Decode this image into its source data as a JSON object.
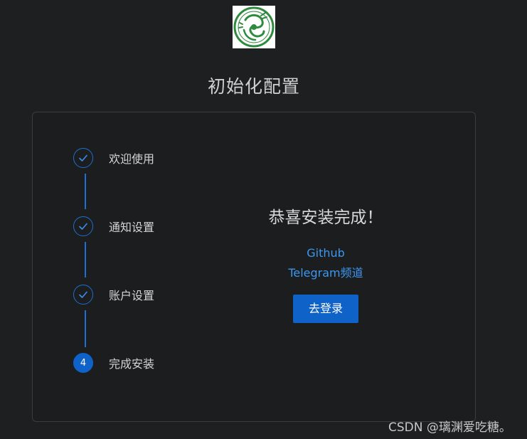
{
  "header": {
    "logo_icon": "dragon-logo-icon",
    "title": "初始化配置"
  },
  "steps": [
    {
      "label": "欢迎使用",
      "status": "done",
      "icon": "check-icon"
    },
    {
      "label": "通知设置",
      "status": "done",
      "icon": "check-icon"
    },
    {
      "label": "账户设置",
      "status": "done",
      "icon": "check-icon"
    },
    {
      "label": "完成安装",
      "status": "current",
      "number": "4"
    }
  ],
  "result": {
    "title": "恭喜安装完成！",
    "links": [
      "Github",
      "Telegram频道"
    ],
    "login_label": "去登录"
  },
  "watermark": "CSDN @璃渊爱吃糖。",
  "colors": {
    "background": "#1d1f21",
    "accent": "#0f62c8",
    "link": "#3d97f0",
    "logo_green": "#2e8b3e"
  }
}
